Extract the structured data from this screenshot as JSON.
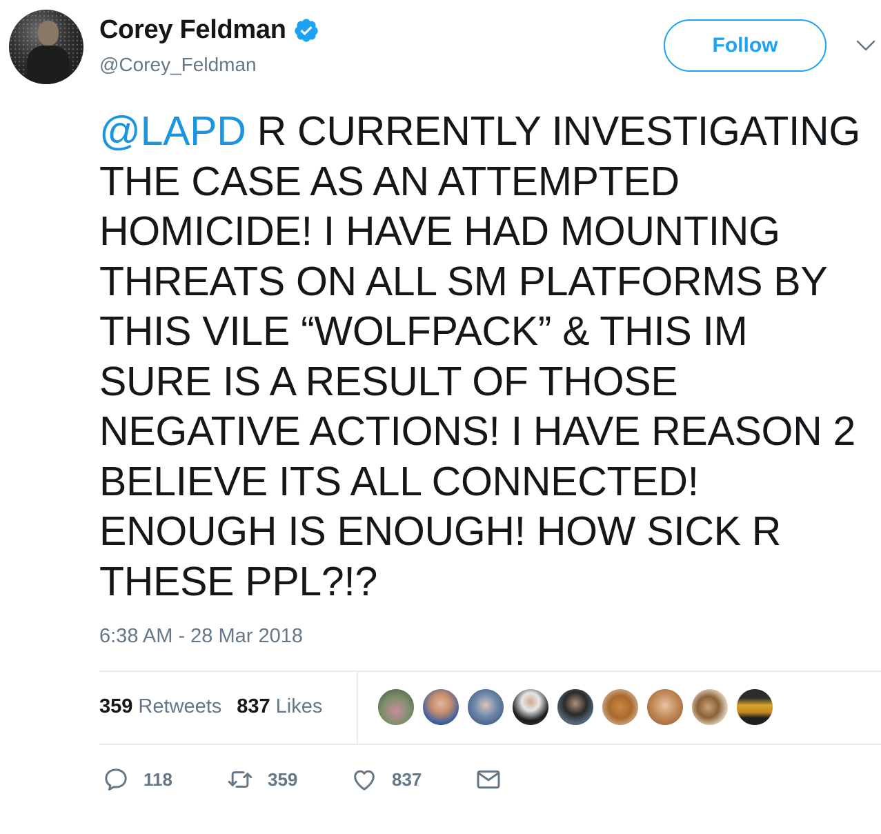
{
  "author": {
    "display_name": "Corey Feldman",
    "handle": "@Corey_Feldman",
    "verified": true
  },
  "follow_button": {
    "label": "Follow"
  },
  "tweet": {
    "lines": [
      {
        "mention": "@LAPD",
        "text": " R CURRENTLY INVESTIGATING"
      },
      {
        "text": "THE CASE AS AN ATTEMPTED"
      },
      {
        "text": "HOMICIDE! I HAVE HAD MOUNTING"
      },
      {
        "text": "THREATS ON ALL SM PLATFORMS BY"
      },
      {
        "text": "THIS VILE “WOLFPACK” & THIS IM"
      },
      {
        "text": "SURE IS A RESULT OF THOSE"
      },
      {
        "text": "NEGATIVE ACTIONS! I HAVE REASON 2"
      },
      {
        "text": "BELIEVE ITS ALL CONNECTED!"
      },
      {
        "text": "ENOUGH IS ENOUGH! HOW SICK R"
      },
      {
        "text": "THESE PPL?!?"
      }
    ],
    "timestamp": "6:38 AM - 28 Mar 2018"
  },
  "stats": {
    "retweets": {
      "count": "359",
      "label": "Retweets"
    },
    "likes": {
      "count": "837",
      "label": "Likes"
    }
  },
  "actions": {
    "reply": {
      "icon": "reply-icon",
      "count": "118"
    },
    "retweet": {
      "icon": "retweet-icon",
      "count": "359"
    },
    "like": {
      "icon": "heart-icon",
      "count": "837"
    },
    "dm": {
      "icon": "envelope-icon"
    }
  },
  "colors": {
    "accent": "#1da1f2",
    "mention": "#1b95e0",
    "muted": "#657786",
    "text": "#14171a",
    "divider": "#e6ecf0"
  }
}
